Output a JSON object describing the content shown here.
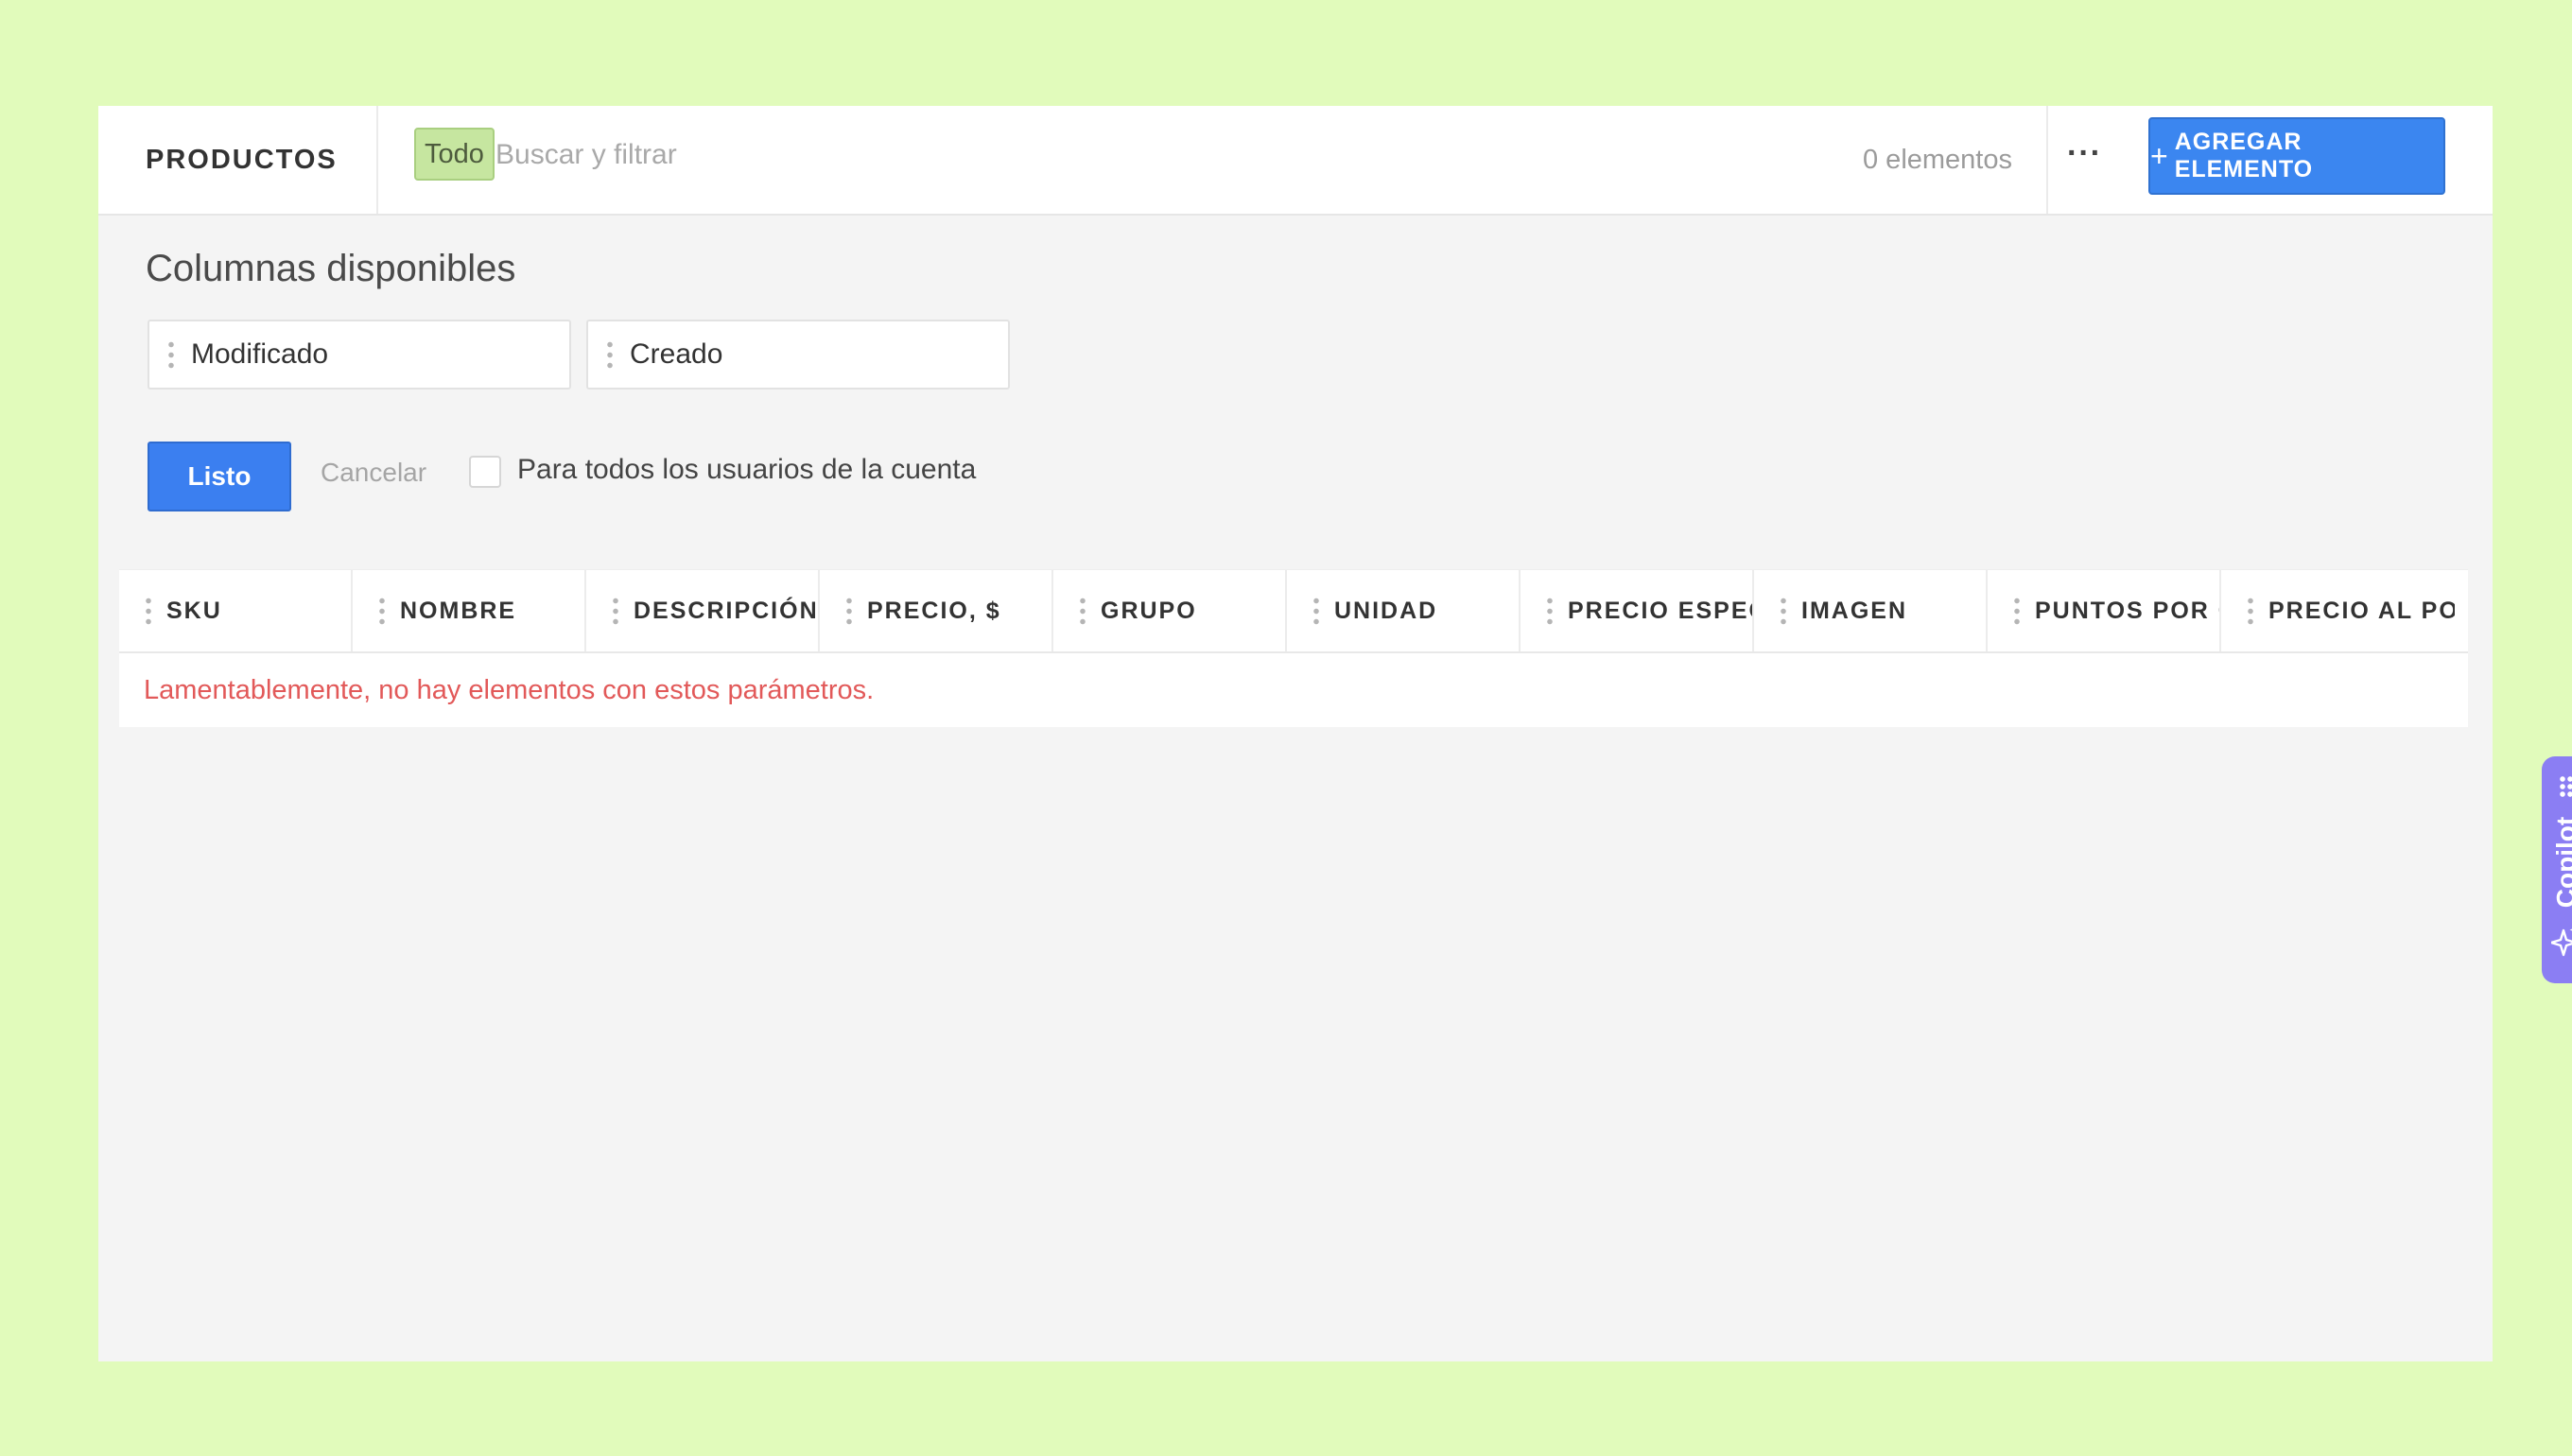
{
  "header": {
    "title": "PRODUCTOS",
    "filter_tag": "Todo",
    "search_placeholder": "Buscar y filtrar",
    "count_text": "0 elementos",
    "more_label": "···",
    "add_button_label": "AGREGAR ELEMENTO",
    "add_button_icon": "plus-icon"
  },
  "columns_panel": {
    "title": "Columnas disponibles",
    "available_columns": [
      "Modificado",
      "Creado"
    ],
    "done_button": "Listo",
    "cancel_button": "Cancelar",
    "all_users_checkbox_label": "Para todos los usuarios de la cuenta",
    "all_users_checked": false
  },
  "table": {
    "columns": [
      "SKU",
      "NOMBRE",
      "DESCRIPCIÓN",
      "PRECIO, $",
      "GRUPO",
      "UNIDAD",
      "PRECIO ESPECIAL",
      "IMAGEN",
      "PUNTOS POR COMPRA",
      "PRECIO AL POR MAYOR"
    ],
    "empty_message": "Lamentablemente, no hay elementos con estos parámetros."
  },
  "copilot": {
    "label": "Copilot",
    "icon": "sparkle-icon"
  },
  "colors": {
    "page_background": "#e1fbbb",
    "primary_button": "#3b86f0",
    "filter_tag_bg": "#c6e6a0",
    "empty_message": "#e25959",
    "copilot_bg": "#8b7ef3",
    "annotation": "#9be36a"
  }
}
